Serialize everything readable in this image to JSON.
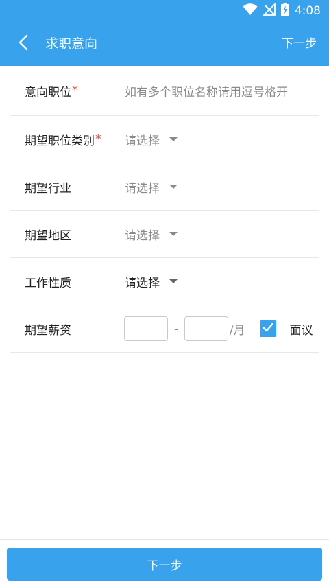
{
  "statusbar": {
    "time": "4:08",
    "icons": [
      "wifi-icon",
      "no-signal-icon",
      "battery-charging-icon"
    ]
  },
  "appbar": {
    "back_icon": "chevron-left-icon",
    "title": "求职意向",
    "next_label": "下一步"
  },
  "form": {
    "position": {
      "label": "意向职位",
      "required_mark": "*",
      "placeholder": "如有多个职位名称请用逗号格开"
    },
    "category": {
      "label": "期望职位类别",
      "required_mark": "*",
      "value": "请选择"
    },
    "industry": {
      "label": "期望行业",
      "value": "请选择"
    },
    "region": {
      "label": "期望地区",
      "value": "请选择"
    },
    "job_type": {
      "label": "工作性质",
      "value": "请选择"
    },
    "salary": {
      "label": "期望薪资",
      "separator": "-",
      "unit": "/月",
      "negotiable_label": "面议",
      "negotiable_checked": true
    }
  },
  "bottom": {
    "next_label": "下一步"
  },
  "colors": {
    "primary": "#38a3ec",
    "required": "#e53935",
    "placeholder": "#8a8a8a"
  }
}
